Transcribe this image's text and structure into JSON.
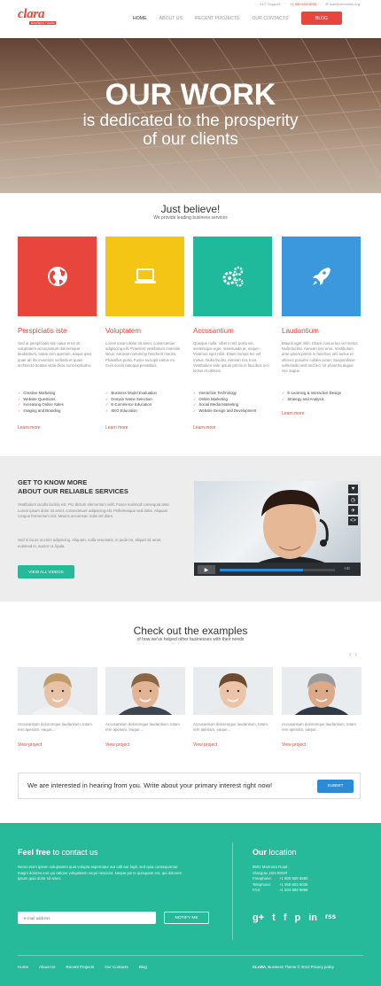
{
  "topbar": {
    "support": "24/7 Support:",
    "phone": "+1 959 603 6035",
    "email": "mail@demolink.org"
  },
  "brand": {
    "name": "clara",
    "tagline": "BUSINESS THEME"
  },
  "nav": {
    "items": [
      "Home",
      "About Us",
      "Recent Projects",
      "Our Contacts"
    ],
    "blog_label": "Blog"
  },
  "hero": {
    "title": "OUR WORK",
    "line1": "is dedicated to the prosperity",
    "line2": "of our clients"
  },
  "believe": {
    "title": "Just believe!",
    "subtitle": "We provide leading business services",
    "features": [
      {
        "color": "#e8453c",
        "icon": "globe-icon",
        "title": "Perspiciatis iste",
        "text": "Sed ut perspiciatis iste natus error sit voluptatem accusantium doloremque laudantium, totam rem aperiam, eaque ipsa quae ab illo inventore veritatis et quasi architecto beatae vitae dicta sunt explicabo.",
        "list": [
          "Creative Marketing",
          "Website Questions",
          "Increasing Online Sales",
          "Imaging and Branding"
        ],
        "more": "Learn more"
      },
      {
        "color": "#f4c514",
        "icon": "laptop-icon",
        "title": "Voluptatem",
        "text": "Lorem ipsum dolor sit amet, consectetuer adipiscing elit. Praesent vestibulum molestie lacus. Aenean nonummy hendrerit mauris. Phasellus porta. Fusce suscipit varius mi. Cum sociis natoque penatibus.",
        "list": [
          "Business Model Evaluation",
          "Domain Name Selection",
          "E-Commerce Education",
          "SEO Education"
        ],
        "more": "Learn more"
      },
      {
        "color": "#1fba9c",
        "icon": "gears-icon",
        "title": "Accusantium",
        "text": "Quisque nulla. Vibero nisl, porta vel, scelerisque eget, malesuada at, neque. Vivamus eget nibh. Etiam cursus leo vel metus. Nulla facilisi. Aenean nec eros. Vestibulum ante ipsum primis in faucibus orci luctus et ultrices.",
        "list": [
          "Interactive Technology",
          "Online Marketing",
          "Social Media Marketing",
          "Website Design and Development"
        ],
        "more": "Learn more"
      },
      {
        "color": "#3b98dc",
        "icon": "rocket-icon",
        "title": "Laudantium",
        "text": "Mauris eget nibh. Etiam cursus leo vel metus. Nulla facilisi. Aenean nec eros. Vestibulum ante ipsum primis in faucibus orci luctus et ultrices posuere cubilia curae; Suspendisse sollicitudin velit sed leo. Ut pharetra augue nec augue.",
        "list": [
          "E-Learning & Interactive Design",
          "Strategy and Analysis"
        ],
        "more": "Learn more"
      }
    ]
  },
  "services": {
    "title_line1": "Get to know more",
    "title_line2": "about our reliable services",
    "para1": "Vestibulum iaculis lacinia est. Pro dictum elementum velit. Fusce euismod consequat ante. Lorem ipsum dolor sit amet, consectetuer adipiscing elit. Pellentesque sed dolor. Aliquam congue fermentum nisl. Mauris accumsan nulla vel diam.",
    "para2": "Sed in lacus ut enim adipiscing. Aliquam, nulla venenatis, in pede mi, aliquet sit amet, euismod in, auctor ut, ligula.",
    "button": "View all videos",
    "video": {
      "play": "▶",
      "hd": "HD",
      "side_icons": [
        "♥",
        "◷",
        "✈",
        "<>"
      ],
      "progress": 0.72
    }
  },
  "examples": {
    "title": "Check out the examples",
    "subtitle": "of how we've helped other businesses with their needs",
    "arrows": "‹›",
    "items": [
      {
        "text": "Accusantium doloremque laudantium, totam rem aperiam, eaque...",
        "link": "View project",
        "skin": "#e7c2a6",
        "hair": "#c09a6a",
        "shirt": "#f2f2f2"
      },
      {
        "text": "Accusantium doloremque laudantium, totam rem aperiam, eaque...",
        "link": "View project",
        "skin": "#e3b493",
        "hair": "#8a6646",
        "shirt": "#3d4650"
      },
      {
        "text": "Accusantium doloremque laudantium, totam rem aperiam, eaque...",
        "link": "View project",
        "skin": "#ecc5a8",
        "hair": "#6e4a30",
        "shirt": "#e9e9e9"
      },
      {
        "text": "Accusantium doloremque laudantium, totam rem aperiam, eaque...",
        "link": "View project",
        "skin": "#dcaa88",
        "hair": "#9a9a9a",
        "shirt": "#2f3a46"
      }
    ]
  },
  "cta": {
    "text": "We are interested in hearing from you. Write about your primary interest right now!",
    "button": "Submit"
  },
  "footer": {
    "contact_bold": "Feel free",
    "contact_rest": " to contact us",
    "contact_text": "Nemo enim ipsum voluptatem quia volupta aspernatur aut odit aut fugit, sed quia consequuntur magni dolores eos qui ratione voluptatem sequi nesciunt. Neque porro quisquam est, qui dolorem ipsum quia dolor sit amet.",
    "location_bold": "Our",
    "location_rest": " location",
    "address": [
      "8901 Marmora Road",
      "Glasgow, D04 89GR"
    ],
    "freephone_label": "Freephone:",
    "freephone": "+1 800 559 6580",
    "telephone_label": "Telephone:",
    "telephone": "+1 959 603 6035",
    "fax_label": "FAX:",
    "fax": "+1 504 889 9898",
    "email_placeholder": "e-mail address",
    "notify": "Notify me",
    "socials": [
      "g+",
      "t",
      "f",
      "p",
      "in",
      "rss"
    ],
    "nav": [
      "Home",
      "About Us",
      "Recent Projects",
      "Our Contacts",
      "Blog"
    ],
    "copyright_bold": "CLARA",
    "copyright_rest": ", Business Theme © 2013 Privacy policy"
  }
}
